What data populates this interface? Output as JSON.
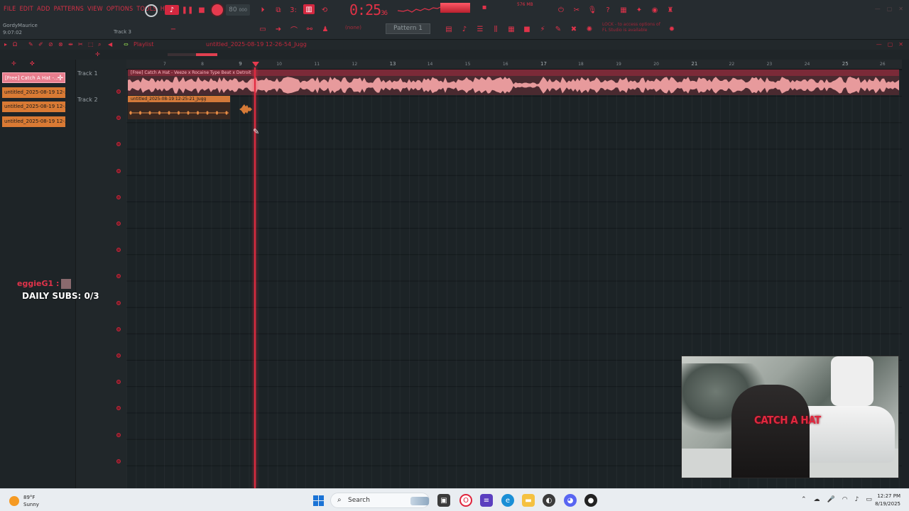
{
  "menu": [
    "FILE",
    "EDIT",
    "ADD",
    "PATTERNS",
    "VIEW",
    "OPTIONS",
    "TOOLS",
    "HELP"
  ],
  "user": {
    "name": "GordyMaurice",
    "time": "9:07:02"
  },
  "toolbar": {
    "tempo": "80",
    "tempo_decimals": "000",
    "time_main": "0:25",
    "time_sub": "36",
    "cpu_label": "576 MB",
    "pattern": "Pattern 1",
    "mode": "(none)",
    "hint_line1": "LOCK - to access options of",
    "hint_line2": "FL Studio is available",
    "track_selector": "Track 3"
  },
  "playlist": {
    "title": "Playlist",
    "path": "untitled_2025-08-19 12-26-54_Jugg",
    "ruler": [
      {
        "n": "7",
        "big": false
      },
      {
        "n": "8",
        "big": false
      },
      {
        "n": "9",
        "big": true
      },
      {
        "n": "10",
        "big": false
      },
      {
        "n": "11",
        "big": false
      },
      {
        "n": "12",
        "big": false
      },
      {
        "n": "13",
        "big": true
      },
      {
        "n": "14",
        "big": false
      },
      {
        "n": "15",
        "big": false
      },
      {
        "n": "16",
        "big": false
      },
      {
        "n": "17",
        "big": true
      },
      {
        "n": "18",
        "big": false
      },
      {
        "n": "19",
        "big": false
      },
      {
        "n": "20",
        "big": false
      },
      {
        "n": "21",
        "big": true
      },
      {
        "n": "22",
        "big": false
      },
      {
        "n": "23",
        "big": false
      },
      {
        "n": "24",
        "big": false
      },
      {
        "n": "25",
        "big": true
      },
      {
        "n": "26",
        "big": false
      }
    ],
    "tracks": [
      "Track 1",
      "Track 2"
    ],
    "track1_clip": "[Free] Catch A Hat - Veeze x Rocaine Type Beat x Detroit",
    "track2_clip": "untitled_2025-08-19 12-25-21_Jugg"
  },
  "clips": [
    {
      "label": "[Free] Catch A Hat -...",
      "selected": true
    },
    {
      "label": "untitled_2025-08-19 12-...",
      "selected": false
    },
    {
      "label": "untitled_2025-08-19 12-...",
      "selected": false
    },
    {
      "label": "untitled_2025-08-19 12-...",
      "selected": false
    }
  ],
  "overlay": {
    "chatter": "eggieG1 :",
    "subs": "DAILY SUBS: 0/3",
    "video_title": "CATCH A HAT"
  },
  "taskbar": {
    "temp": "89°F",
    "condition": "Sunny",
    "search": "Search",
    "time": "12:27 PM",
    "date": "8/19/2025"
  },
  "colors": {
    "accent": "#e0334a",
    "clip_orange": "#d97a34",
    "track1": "#7b2a38"
  }
}
